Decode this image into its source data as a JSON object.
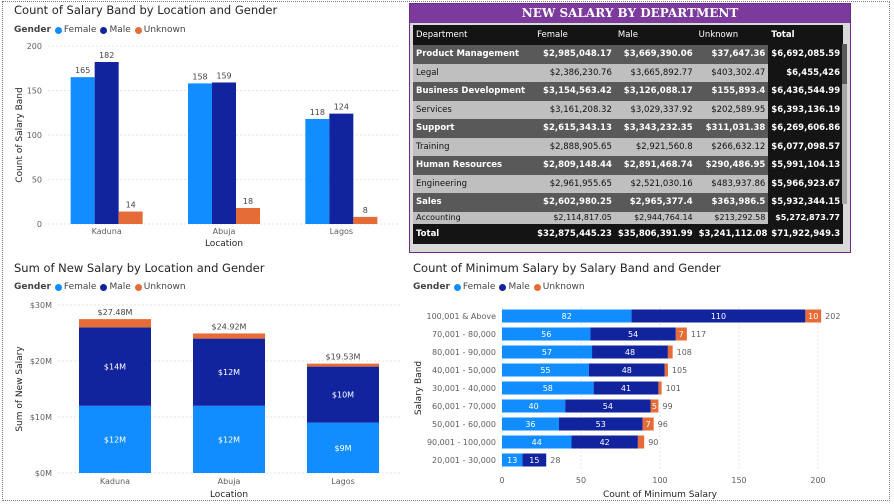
{
  "colors": {
    "female": "#118DFF",
    "male": "#12239E",
    "unknown": "#E66C37",
    "header_purple": "#7B3A9C"
  },
  "legend": {
    "label": "Gender",
    "items": [
      "Female",
      "Male",
      "Unknown"
    ]
  },
  "chart1": {
    "title": "Count of Salary Band by Location and Gender",
    "chart_data": {
      "type": "bar",
      "title": "Count of Salary Band by Location and Gender",
      "categories": [
        "Kaduna",
        "Abuja",
        "Lagos"
      ],
      "series": [
        {
          "name": "Female",
          "values": [
            165,
            158,
            118
          ]
        },
        {
          "name": "Male",
          "values": [
            182,
            159,
            124
          ]
        },
        {
          "name": "Unknown",
          "values": [
            14,
            18,
            8
          ]
        }
      ],
      "xlabel": "Location",
      "ylabel": "Count of Salary Band",
      "ylim": [
        0,
        200
      ],
      "yticks": [
        0,
        50,
        100,
        150,
        200
      ],
      "grid": true,
      "legend": "top-left"
    }
  },
  "chart2": {
    "title": "Sum of New Salary by Location and Gender",
    "chart_data": {
      "type": "bar",
      "stacked": true,
      "title": "Sum of New Salary by Location and Gender",
      "categories": [
        "Kaduna",
        "Abuja",
        "Lagos"
      ],
      "series": [
        {
          "name": "Female",
          "values": [
            12,
            12,
            9
          ],
          "labels": [
            "$12M",
            "$12M",
            "$9M"
          ]
        },
        {
          "name": "Male",
          "values": [
            14,
            12,
            10
          ],
          "labels": [
            "$14M",
            "$12M",
            "$10M"
          ]
        },
        {
          "name": "Unknown",
          "values": [
            1.48,
            0.92,
            0.53
          ]
        }
      ],
      "totals": [
        27.48,
        24.92,
        19.53
      ],
      "total_labels": [
        "$27.48M",
        "$24.92M",
        "$19.53M"
      ],
      "xlabel": "Location",
      "ylabel": "Sum of New Salary",
      "ylim": [
        0,
        30
      ],
      "yticks": [
        0,
        10,
        20,
        30
      ],
      "ytick_labels": [
        "$0M",
        "$10M",
        "$20M",
        "$30M"
      ],
      "grid": true,
      "legend": "top-left"
    }
  },
  "chart3": {
    "title": "Count of Minimum Salary by Salary Band and Gender",
    "chart_data": {
      "type": "bar",
      "orientation": "horizontal",
      "stacked": true,
      "title": "Count of Minimum Salary by Salary Band and Gender",
      "categories": [
        "100,001 & Above",
        "70,001 - 80,000",
        "80,001 - 90,000",
        "40,001 - 50,000",
        "30,001 - 40,000",
        "60,001 - 70,000",
        "50,001 - 60,000",
        "90,001 - 100,000",
        "20,001 - 30,000"
      ],
      "series": [
        {
          "name": "Female",
          "values": [
            82,
            56,
            57,
            55,
            58,
            40,
            36,
            44,
            13
          ]
        },
        {
          "name": "Male",
          "values": [
            110,
            54,
            48,
            48,
            41,
            54,
            53,
            42,
            15
          ]
        },
        {
          "name": "Unknown",
          "values": [
            10,
            7,
            3,
            2,
            2,
            5,
            7,
            4,
            0
          ]
        }
      ],
      "totals": [
        202,
        117,
        108,
        105,
        101,
        99,
        96,
        90,
        28
      ],
      "xlabel": "Count of Minimum Salary",
      "ylabel": "Salary Band",
      "xlim": [
        0,
        200
      ],
      "xticks": [
        0,
        50,
        100,
        150,
        200
      ],
      "grid": true,
      "legend": "top-left"
    }
  },
  "table": {
    "title": "NEW SALARY BY DEPARTMENT",
    "columns": [
      "Department",
      "Female",
      "Male",
      "Unknown",
      "Total"
    ],
    "rows": [
      [
        "Product Management",
        "$2,985,048.17",
        "$3,669,390.06",
        "$37,647.36",
        "$6,692,085.59"
      ],
      [
        "Legal",
        "$2,386,230.76",
        "$3,665,892.77",
        "$403,302.47",
        "$6,455,426"
      ],
      [
        "Business Development",
        "$3,154,563.42",
        "$3,126,088.17",
        "$155,893.4",
        "$6,436,544.99"
      ],
      [
        "Services",
        "$3,161,208.32",
        "$3,029,337.92",
        "$202,589.95",
        "$6,393,136.19"
      ],
      [
        "Support",
        "$2,615,343.13",
        "$3,343,232.35",
        "$311,031.38",
        "$6,269,606.86"
      ],
      [
        "Training",
        "$2,888,905.65",
        "$2,921,560.8",
        "$266,632.12",
        "$6,077,098.57"
      ],
      [
        "Human Resources",
        "$2,809,148.44",
        "$2,891,468.74",
        "$290,486.95",
        "$5,991,104.13"
      ],
      [
        "Engineering",
        "$2,961,955.65",
        "$2,521,030.16",
        "$483,937.86",
        "$5,966,923.67"
      ],
      [
        "Sales",
        "$2,602,980.25",
        "$2,965,377.4",
        "$363,986.5",
        "$5,932,344.15"
      ]
    ],
    "partial_row": [
      "Accounting",
      "$2,114,817.05",
      "$2,944,764.14",
      "$213,292.58",
      "$5,272,873.77"
    ],
    "total_row": [
      "Total",
      "$32,875,445.23",
      "$35,806,391.99",
      "$3,241,112.08",
      "$71,922,949.3"
    ]
  }
}
